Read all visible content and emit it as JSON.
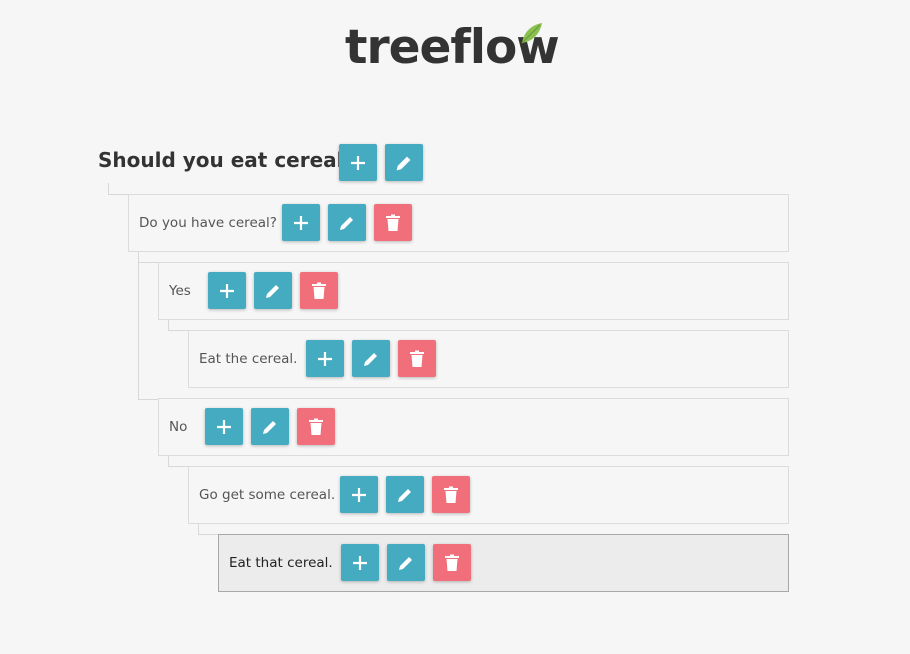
{
  "logo": {
    "text": "treeflow"
  },
  "root": {
    "title": "Should you eat cereal?"
  },
  "nodes": [
    {
      "label": "Do you have cereal?"
    },
    {
      "label": "Yes"
    },
    {
      "label": "Eat the cereal."
    },
    {
      "label": "No"
    },
    {
      "label": "Go get some cereal."
    },
    {
      "label": "Eat that cereal."
    }
  ],
  "colors": {
    "add": "#44abc0",
    "edit": "#44abc0",
    "delete": "#f06f7b",
    "leaf": "#8cc152"
  },
  "icons": {
    "add": "plus-icon",
    "edit": "pencil-icon",
    "delete": "trash-icon"
  }
}
